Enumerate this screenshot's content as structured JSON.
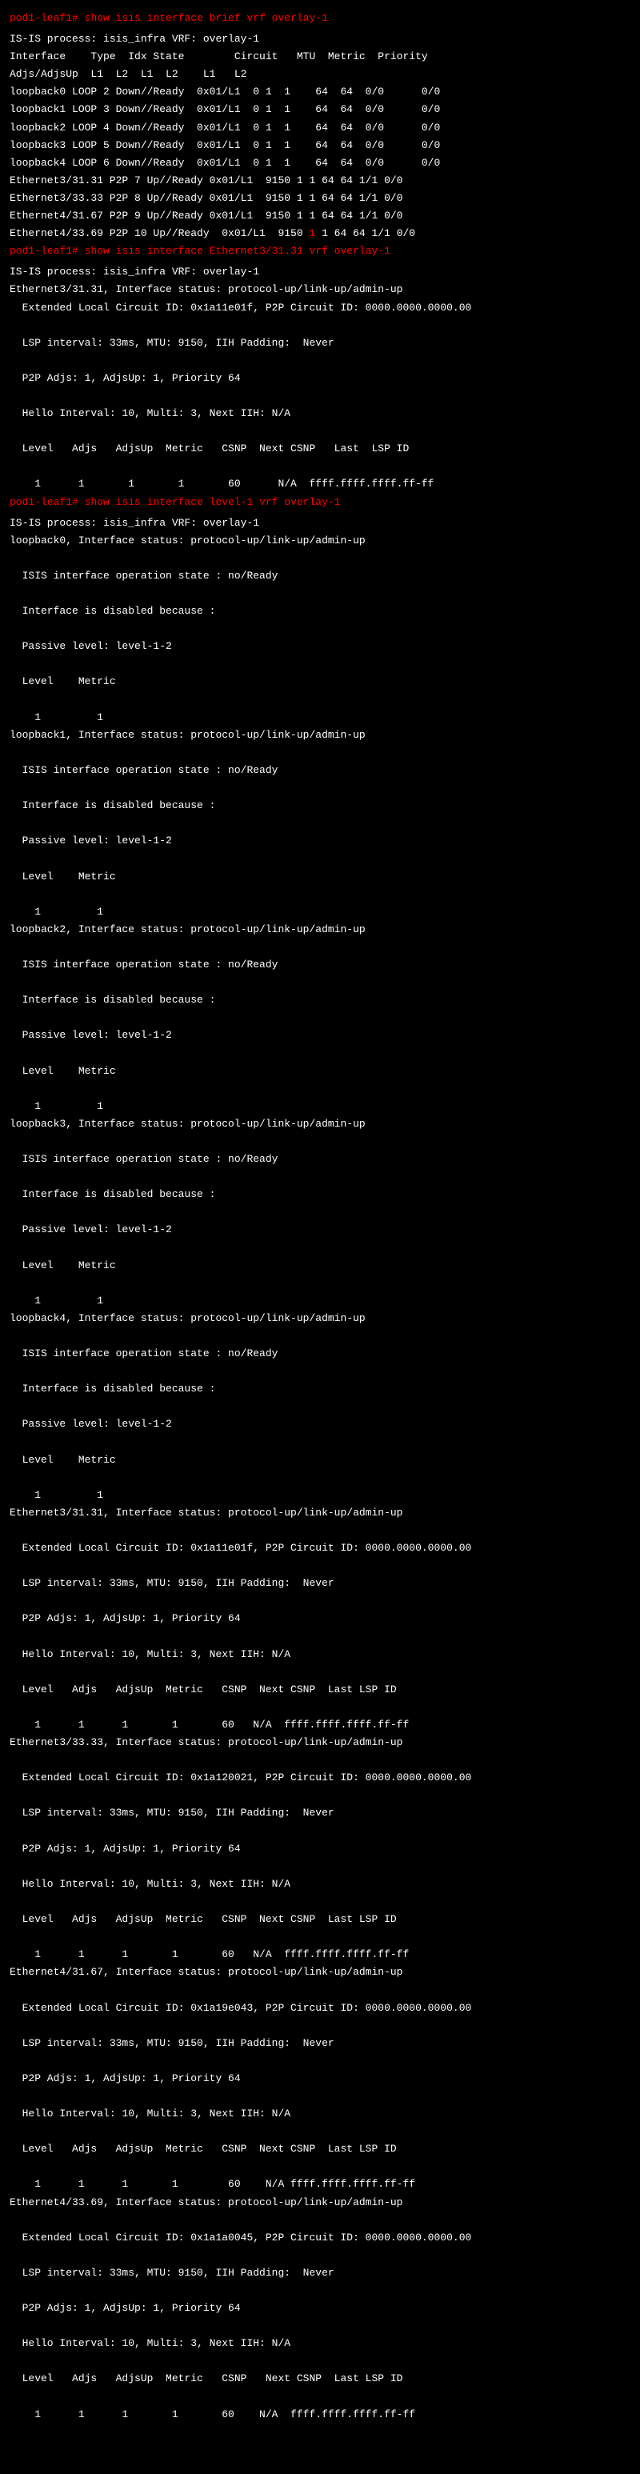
{
  "cmd1": {
    "prompt": "pod1-leaf1#",
    "command": "show isis interface brief vrf overlay-1",
    "line1": "IS-IS process: isis_infra VRF: overlay-1",
    "header1": "Interface    Type  Idx State        Circuit   MTU  Metric  Priority",
    "header2": "Adjs/AdjsUp  L1  L2  L1  L2    L1   L2",
    "rows": [
      "loopback0 LOOP 2 Down//Ready  0x01/L1  0 1  1    64  64  0/0      0/0",
      "loopback1 LOOP 3 Down//Ready  0x01/L1  0 1  1    64  64  0/0      0/0",
      "loopback2 LOOP 4 Down//Ready  0x01/L1  0 1  1    64  64  0/0      0/0",
      "loopback3 LOOP 5 Down//Ready  0x01/L1  0 1  1    64  64  0/0      0/0",
      "loopback4 LOOP 6 Down//Ready  0x01/L1  0 1  1    64  64  0/0      0/0",
      "Ethernet3/31.31 P2P 7 Up//Ready 0x01/L1  9150 1 1 64 64 1/1 0/0",
      "Ethernet3/33.33 P2P 8 Up//Ready 0x01/L1  9150 1 1 64 64 1/1 0/0",
      "Ethernet4/31.67 P2P 9 Up//Ready 0x01/L1  9150 1 1 64 64 1/1 0/0"
    ],
    "row_red_a": "Ethernet4/33.69 P2P 10 Up//Ready  0x01/L1  9150 ",
    "row_red_b": "1",
    "row_red_c": " 1 64 64 1/1 0/0"
  },
  "cmd2": {
    "prompt": "pod1-leaf1#",
    "command": "show isis interface Ethernet3/31.31 vrf overlay-1",
    "lines": [
      "IS-IS process: isis_infra VRF: overlay-1",
      "Ethernet3/31.31, Interface status: protocol-up/link-up/admin-up",
      "  Extended Local Circuit ID: 0x1a11e01f, P2P Circuit ID: 0000.0000.0000.00",
      "",
      "  LSP interval: 33ms, MTU: 9150, IIH Padding:  Never",
      "",
      "  P2P Adjs: 1, AdjsUp: 1, Priority 64",
      "",
      "  Hello Interval: 10, Multi: 3, Next IIH: N/A",
      "",
      "  Level   Adjs   AdjsUp  Metric   CSNP  Next CSNP   Last  LSP ID",
      "",
      "    1      1       1       1       60      N/A  ffff.ffff.ffff.ff-ff"
    ]
  },
  "cmd3": {
    "prompt": "pod1-leaf1#",
    "command": "show isis interface level-1 vrf overlay-1",
    "line1": "IS-IS process: isis_infra VRF: overlay-1",
    "loopbacks": [
      {
        "name": "loopback0",
        "lines": [
          "loopback0, Interface status: protocol-up/link-up/admin-up",
          "",
          "  ISIS interface operation state : no/Ready",
          "",
          "  Interface is disabled because :",
          "",
          "  Passive level: level-1-2",
          "",
          "  Level    Metric",
          "",
          "    1         1"
        ]
      },
      {
        "name": "loopback1",
        "lines": [
          "loopback1, Interface status: protocol-up/link-up/admin-up",
          "",
          "  ISIS interface operation state : no/Ready",
          "",
          "  Interface is disabled because :",
          "",
          "  Passive level: level-1-2",
          "",
          "  Level    Metric",
          "",
          "    1         1"
        ]
      },
      {
        "name": "loopback2",
        "lines": [
          "loopback2, Interface status: protocol-up/link-up/admin-up",
          "",
          "  ISIS interface operation state : no/Ready",
          "",
          "  Interface is disabled because :",
          "",
          "  Passive level: level-1-2",
          "",
          "  Level    Metric",
          "",
          "    1         1"
        ]
      },
      {
        "name": "loopback3",
        "lines": [
          "loopback3, Interface status: protocol-up/link-up/admin-up",
          "",
          "  ISIS interface operation state : no/Ready",
          "",
          "  Interface is disabled because :",
          "",
          "  Passive level: level-1-2",
          "",
          "  Level    Metric",
          "",
          "    1         1"
        ]
      },
      {
        "name": "loopback4",
        "lines": [
          "loopback4, Interface status: protocol-up/link-up/admin-up",
          "",
          "  ISIS interface operation state : no/Ready",
          "",
          "  Interface is disabled because :",
          "",
          "  Passive level: level-1-2",
          "",
          "  Level    Metric",
          "",
          "    1         1"
        ]
      }
    ],
    "ethernets": [
      {
        "name": "Ethernet3/31.31",
        "lines": [
          "Ethernet3/31.31, Interface status: protocol-up/link-up/admin-up",
          "",
          "  Extended Local Circuit ID: 0x1a11e01f, P2P Circuit ID: 0000.0000.0000.00",
          "",
          "  LSP interval: 33ms, MTU: 9150, IIH Padding:  Never",
          "",
          "  P2P Adjs: 1, AdjsUp: 1, Priority 64",
          "",
          "  Hello Interval: 10, Multi: 3, Next IIH: N/A",
          "",
          "  Level   Adjs   AdjsUp  Metric   CSNP  Next CSNP  Last LSP ID",
          "",
          "    1      1      1       1       60   N/A  ffff.ffff.ffff.ff-ff"
        ]
      },
      {
        "name": "Ethernet3/33.33",
        "lines": [
          "Ethernet3/33.33, Interface status: protocol-up/link-up/admin-up",
          "",
          "  Extended Local Circuit ID: 0x1a120021, P2P Circuit ID: 0000.0000.0000.00",
          "",
          "  LSP interval: 33ms, MTU: 9150, IIH Padding:  Never",
          "",
          "  P2P Adjs: 1, AdjsUp: 1, Priority 64",
          "",
          "  Hello Interval: 10, Multi: 3, Next IIH: N/A",
          "",
          "  Level   Adjs   AdjsUp  Metric   CSNP  Next CSNP  Last LSP ID",
          "",
          "    1      1      1       1       60   N/A  ffff.ffff.ffff.ff-ff"
        ]
      },
      {
        "name": "Ethernet4/31.67",
        "lines": [
          "Ethernet4/31.67, Interface status: protocol-up/link-up/admin-up",
          "",
          "  Extended Local Circuit ID: 0x1a19e043, P2P Circuit ID: 0000.0000.0000.00",
          "",
          "  LSP interval: 33ms, MTU: 9150, IIH Padding:  Never",
          "",
          "  P2P Adjs: 1, AdjsUp: 1, Priority 64",
          "",
          "  Hello Interval: 10, Multi: 3, Next IIH: N/A",
          "",
          "  Level   Adjs   AdjsUp  Metric   CSNP  Next CSNP  Last LSP ID",
          "",
          "    1      1      1       1        60    N/A ffff.ffff.ffff.ff-ff"
        ]
      },
      {
        "name": "Ethernet4/33.69",
        "lines": [
          "Ethernet4/33.69, Interface status: protocol-up/link-up/admin-up",
          "",
          "  Extended Local Circuit ID: 0x1a1a0045, P2P Circuit ID: 0000.0000.0000.00",
          "",
          "  LSP interval: 33ms, MTU: 9150, IIH Padding:  Never",
          "",
          "  P2P Adjs: 1, AdjsUp: 1, Priority 64",
          "",
          "  Hello Interval: 10, Multi: 3, Next IIH: N/A",
          "",
          "  Level   Adjs   AdjsUp  Metric   CSNP   Next CSNP  Last LSP ID",
          "",
          "    1      1      1       1       60    N/A  ffff.ffff.ffff.ff-ff"
        ]
      }
    ]
  }
}
